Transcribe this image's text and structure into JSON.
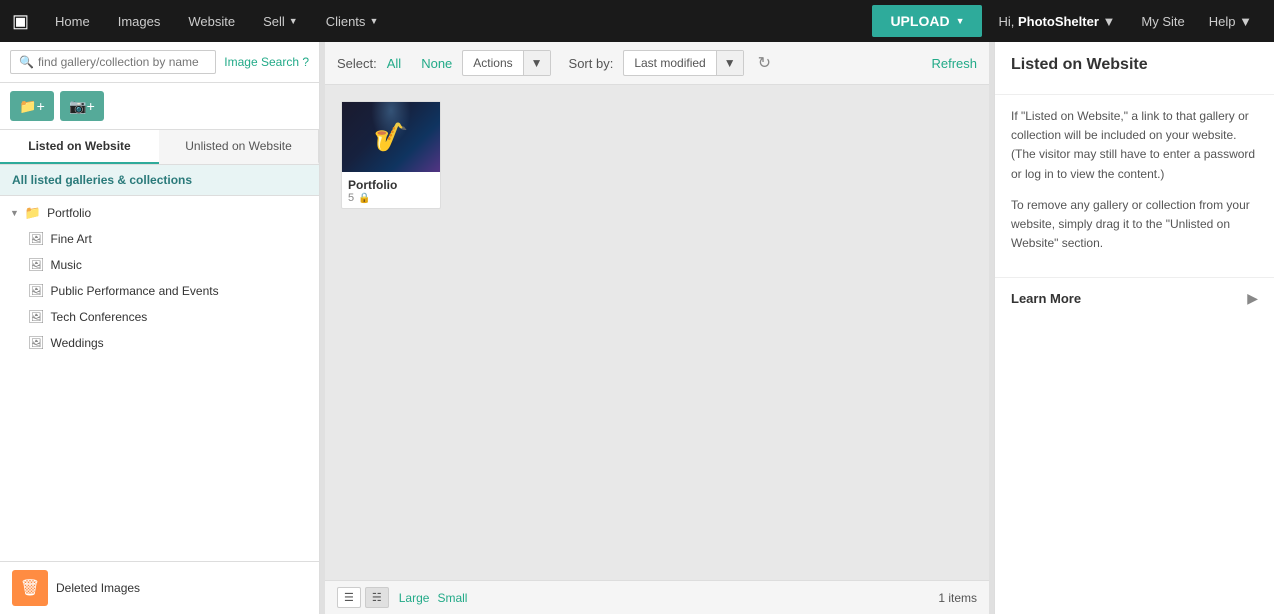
{
  "topnav": {
    "logo_icon": "camera-icon",
    "items": [
      {
        "label": "Home",
        "has_caret": false
      },
      {
        "label": "Images",
        "has_caret": false
      },
      {
        "label": "Website",
        "has_caret": false
      },
      {
        "label": "Sell",
        "has_caret": true
      },
      {
        "label": "Clients",
        "has_caret": true
      }
    ],
    "upload_label": "UPLOAD",
    "user_greeting": "Hi,",
    "user_name": "PhotoShelter",
    "mysite_label": "My Site",
    "help_label": "Help"
  },
  "sidebar": {
    "search_placeholder": "find gallery/collection by name",
    "image_search_label": "Image Search ?",
    "btn_new_folder_icon": "folder-plus-icon",
    "btn_new_gallery_icon": "image-plus-icon",
    "tab_listed": "Listed on Website",
    "tab_unlisted": "Unlisted on Website",
    "all_galleries_label": "All listed galleries & collections",
    "tree": [
      {
        "id": "portfolio",
        "label": "Portfolio",
        "type": "folder",
        "level": 0,
        "expanded": true
      },
      {
        "id": "fine-art",
        "label": "Fine Art",
        "type": "gallery",
        "level": 1
      },
      {
        "id": "music",
        "label": "Music",
        "type": "gallery",
        "level": 1
      },
      {
        "id": "public-performance",
        "label": "Public Performance and Events",
        "type": "gallery",
        "level": 1
      },
      {
        "id": "tech-conferences",
        "label": "Tech Conferences",
        "type": "gallery",
        "level": 1
      },
      {
        "id": "weddings",
        "label": "Weddings",
        "type": "gallery",
        "level": 1
      }
    ],
    "deleted_label": "Deleted Images",
    "deleted_icon": "trash-icon"
  },
  "toolbar": {
    "select_label": "Select:",
    "select_all": "All",
    "select_none": "None",
    "actions_label": "Actions",
    "sort_by_label": "Sort by:",
    "sort_value": "Last modified",
    "refresh_label": "Refresh"
  },
  "gallery": {
    "items": [
      {
        "id": "portfolio",
        "name": "Portfolio",
        "count": "5",
        "has_lock": true
      }
    ]
  },
  "bottom_bar": {
    "view_list_icon": "list-icon",
    "view_grid_icon": "grid-icon",
    "large_label": "Large",
    "small_label": "Small",
    "item_count": "1 items"
  },
  "right_panel": {
    "title": "Listed on Website",
    "body_p1": "If \"Listed on Website,\" a link to that gallery or collection will be included on your website. (The visitor may still have to enter a password or log in to view the content.)",
    "body_p2": "To remove any gallery or collection from your website, simply drag it to the \"Unlisted on Website\" section.",
    "learn_more_label": "Learn More"
  }
}
